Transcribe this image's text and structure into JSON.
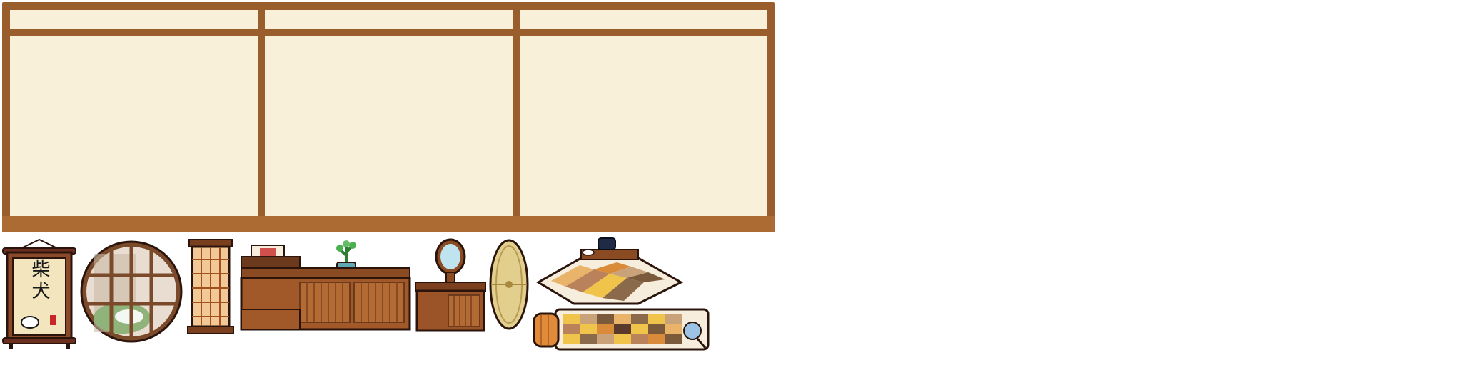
{
  "scene": {
    "background_color": "#ffffff",
    "wall": {
      "name": "shoji-screen-wall",
      "frame_color": "#9a5e2d",
      "sill_color": "#ad6b34",
      "paper_color": "#f9f0da",
      "panel_count": 3
    },
    "items": [
      {
        "name": "hanging-scroll-shiba",
        "label": "柴犬"
      },
      {
        "name": "round-window"
      },
      {
        "name": "lattice-floor-lamp"
      },
      {
        "name": "low-cabinet-with-bonsai"
      },
      {
        "name": "mirror-vanity-stand"
      },
      {
        "name": "rolled-tatami-mat"
      },
      {
        "name": "kotatsu-table"
      },
      {
        "name": "futon-with-pillow"
      }
    ]
  }
}
